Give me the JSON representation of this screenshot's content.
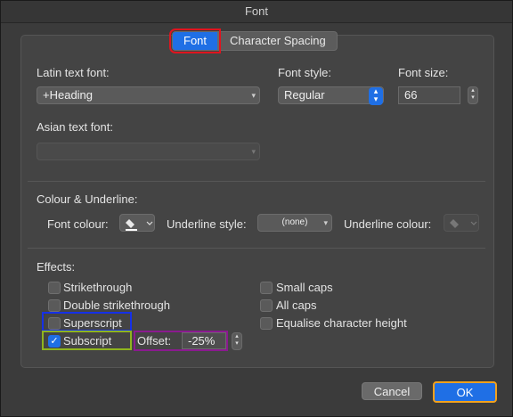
{
  "window": {
    "title": "Font"
  },
  "tabs": [
    {
      "label": "Font",
      "active": true
    },
    {
      "label": "Character Spacing",
      "active": false
    }
  ],
  "latin": {
    "label": "Latin text font:",
    "value": "+Heading"
  },
  "style": {
    "label": "Font style:",
    "value": "Regular"
  },
  "size": {
    "label": "Font size:",
    "value": "66"
  },
  "asian": {
    "label": "Asian text font:",
    "value": ""
  },
  "colour_section": {
    "heading": "Colour & Underline:",
    "font_colour_label": "Font colour:",
    "underline_style_label": "Underline style:",
    "underline_style_value": "(none)",
    "underline_colour_label": "Underline colour:"
  },
  "effects": {
    "heading": "Effects:",
    "items": [
      {
        "label": "Strikethrough",
        "checked": false
      },
      {
        "label": "Double strikethrough",
        "checked": false
      },
      {
        "label": "Superscript",
        "checked": false
      },
      {
        "label": "Subscript",
        "checked": true
      },
      {
        "label": "Small caps",
        "checked": false
      },
      {
        "label": "All caps",
        "checked": false
      },
      {
        "label": "Equalise character height",
        "checked": false
      }
    ],
    "offset_label": "Offset:",
    "offset_value": "-25%"
  },
  "buttons": {
    "cancel": "Cancel",
    "ok": "OK"
  },
  "colors": {
    "accent": "#1f6fe5",
    "highlight_red": "#e0141e",
    "highlight_blue": "#1530e8",
    "highlight_green": "#8fb41e",
    "highlight_purple": "#8a1a8f",
    "highlight_orange": "#f2a11c"
  }
}
